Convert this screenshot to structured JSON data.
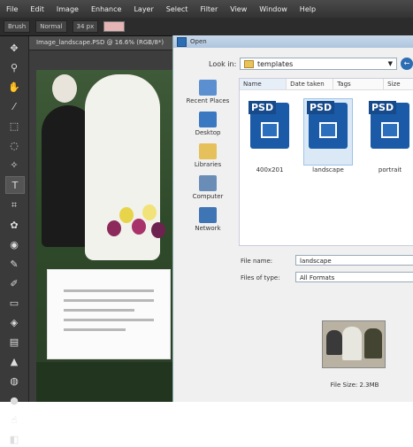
{
  "menubar": {
    "items": [
      "File",
      "Edit",
      "Image",
      "Enhance",
      "Layer",
      "Select",
      "Filter",
      "View",
      "Window",
      "Help"
    ]
  },
  "optbar": {
    "brush_preset": "Brush",
    "mode": "Normal",
    "size": "34 px"
  },
  "toolbox": {
    "icons": [
      "move-icon",
      "zoom-icon",
      "hand-icon",
      "eyedropper-icon",
      "marquee-icon",
      "lasso-icon",
      "magic-wand-icon",
      "type-icon",
      "crop-icon",
      "cookie-cutter-icon",
      "red-eye-icon",
      "brush-icon",
      "pencil-icon",
      "eraser-icon",
      "paint-bucket-icon",
      "gradient-icon",
      "shape-icon",
      "blur-icon",
      "sponge-icon",
      "smudge-icon",
      "color-swatch-icon"
    ]
  },
  "document": {
    "tab_title": "Image_landscape.PSD @ 16.6% (RGB/8*)"
  },
  "dialog": {
    "title": "Open",
    "look_in_label": "Look in:",
    "look_in_value": "templates",
    "places": [
      {
        "label": "Recent Places",
        "color": "#5b8fcf"
      },
      {
        "label": "Desktop",
        "color": "#3a78c2"
      },
      {
        "label": "Libraries",
        "color": "#e6c05a"
      },
      {
        "label": "Computer",
        "color": "#6a8db8"
      },
      {
        "label": "Network",
        "color": "#3f74b5"
      }
    ],
    "columns": {
      "name": "Name",
      "date": "Date taken",
      "tags": "Tags",
      "size": "Size"
    },
    "files": [
      {
        "name": "400x201",
        "tag": "PSD"
      },
      {
        "name": "landscape",
        "tag": "PSD"
      },
      {
        "name": "portrait",
        "tag": "PSD"
      }
    ],
    "filename_label": "File name:",
    "filename_value": "landscape",
    "filetype_label": "Files of type:",
    "filetype_value": "All Formats",
    "file_size": "File Size: 2.3MB"
  }
}
